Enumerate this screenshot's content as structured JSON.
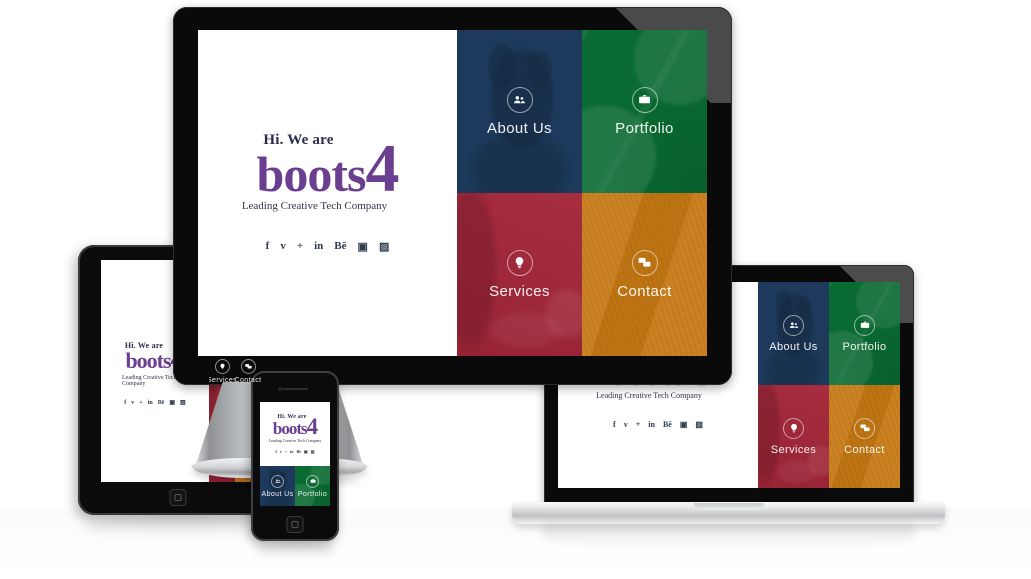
{
  "brand": {
    "greeting": "Hi. We are",
    "name": "boots",
    "numeral": "4",
    "tagline": "Leading Creative Tech Company",
    "purple": "#6b3f8f",
    "dark_ink": "#2b2b4e"
  },
  "socials": [
    {
      "name": "facebook-icon",
      "glyph": "f"
    },
    {
      "name": "twitter-icon",
      "glyph": "ᴠ"
    },
    {
      "name": "google-plus-icon",
      "glyph": "+"
    },
    {
      "name": "linkedin-icon",
      "glyph": "in"
    },
    {
      "name": "behance-icon",
      "glyph": "Bē"
    },
    {
      "name": "flickr-icon",
      "glyph": "▣"
    },
    {
      "name": "instagram-icon",
      "glyph": "▨"
    }
  ],
  "tiles": [
    {
      "key": "about",
      "label": "About Us",
      "icon": "users-icon",
      "glyph": "☰",
      "color": "#1d3a5c"
    },
    {
      "key": "portfolio",
      "label": "Portfolio",
      "icon": "briefcase-icon",
      "glyph": "■",
      "color": "#0a6b32"
    },
    {
      "key": "services",
      "label": "Services",
      "icon": "lightbulb-icon",
      "glyph": "●",
      "color": "#a32638"
    },
    {
      "key": "contact",
      "label": "Contact",
      "icon": "chat-bubbles-icon",
      "glyph": "▣",
      "color": "#c87a14"
    }
  ],
  "devices": [
    {
      "name": "desktop-monitor"
    },
    {
      "name": "tablet"
    },
    {
      "name": "smartphone"
    },
    {
      "name": "laptop"
    }
  ],
  "page": {
    "background": "#ffffff"
  }
}
